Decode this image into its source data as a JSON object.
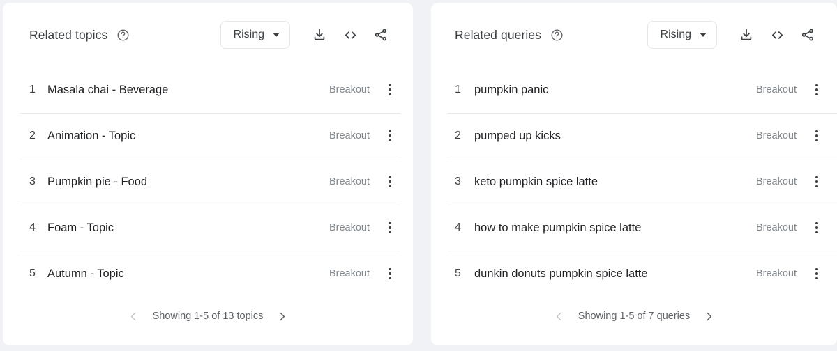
{
  "panels": [
    {
      "title": "Related topics",
      "help_icon": "help-circle-icon",
      "sort": {
        "label": "Rising",
        "caret_icon": "chevron-down-icon"
      },
      "actions": [
        {
          "name": "download-icon",
          "label": "Download"
        },
        {
          "name": "embed-code-icon",
          "label": "Embed"
        },
        {
          "name": "share-icon",
          "label": "Share"
        }
      ],
      "rows": [
        {
          "rank": "1",
          "label": "Masala chai - Beverage",
          "value": "Breakout",
          "menu_icon": "kebab-menu-icon"
        },
        {
          "rank": "2",
          "label": "Animation - Topic",
          "value": "Breakout",
          "menu_icon": "kebab-menu-icon"
        },
        {
          "rank": "3",
          "label": "Pumpkin pie - Food",
          "value": "Breakout",
          "menu_icon": "kebab-menu-icon"
        },
        {
          "rank": "4",
          "label": "Foam - Topic",
          "value": "Breakout",
          "menu_icon": "kebab-menu-icon"
        },
        {
          "rank": "5",
          "label": "Autumn - Topic",
          "value": "Breakout",
          "menu_icon": "kebab-menu-icon"
        }
      ],
      "footer": {
        "prev_icon": "chevron-left-icon",
        "next_icon": "chevron-right-icon",
        "status": "Showing 1-5 of 13 topics"
      }
    },
    {
      "title": "Related queries",
      "help_icon": "help-circle-icon",
      "sort": {
        "label": "Rising",
        "caret_icon": "chevron-down-icon"
      },
      "actions": [
        {
          "name": "download-icon",
          "label": "Download"
        },
        {
          "name": "embed-code-icon",
          "label": "Embed"
        },
        {
          "name": "share-icon",
          "label": "Share"
        }
      ],
      "rows": [
        {
          "rank": "1",
          "label": "pumpkin panic",
          "value": "Breakout",
          "menu_icon": "kebab-menu-icon"
        },
        {
          "rank": "2",
          "label": "pumped up kicks",
          "value": "Breakout",
          "menu_icon": "kebab-menu-icon"
        },
        {
          "rank": "3",
          "label": "keto pumpkin spice latte",
          "value": "Breakout",
          "menu_icon": "kebab-menu-icon"
        },
        {
          "rank": "4",
          "label": "how to make pumpkin spice latte",
          "value": "Breakout",
          "menu_icon": "kebab-menu-icon"
        },
        {
          "rank": "5",
          "label": "dunkin donuts pumpkin spice latte",
          "value": "Breakout",
          "menu_icon": "kebab-menu-icon"
        }
      ],
      "footer": {
        "prev_icon": "chevron-left-icon",
        "next_icon": "chevron-right-icon",
        "status": "Showing 1-5 of 7 queries"
      }
    }
  ],
  "colors": {
    "page_background": "#f1f2f6",
    "card_background": "#ffffff",
    "text_primary": "#202124",
    "text_secondary": "#5f6368",
    "value_text": "#80868b",
    "divider": "#e8eaed"
  }
}
